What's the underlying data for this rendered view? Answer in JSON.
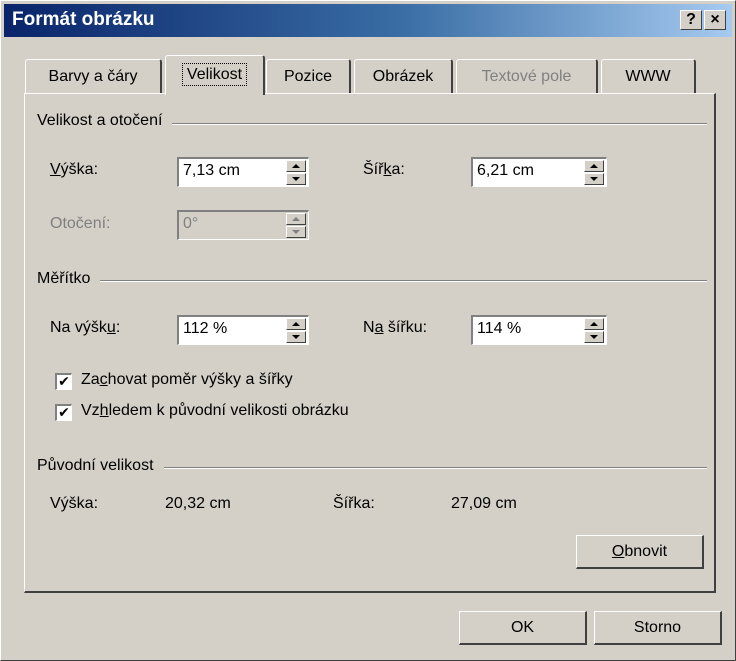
{
  "window": {
    "title": "Formát obrázku",
    "help_button": "?",
    "close_button": "×"
  },
  "tabs": [
    {
      "label": "Barvy a čáry",
      "active": false,
      "disabled": false
    },
    {
      "label": "Velikost",
      "active": true,
      "disabled": false
    },
    {
      "label": "Pozice",
      "active": false,
      "disabled": false
    },
    {
      "label": "Obrázek",
      "active": false,
      "disabled": false
    },
    {
      "label": "Textové pole",
      "active": false,
      "disabled": true
    },
    {
      "label": "WWW",
      "active": false,
      "disabled": false
    }
  ],
  "size_rotation": {
    "group_label": "Velikost a otočení",
    "height_label_accel": "V",
    "height_label_rest": "ýška:",
    "height_value": "7,13 cm",
    "width_label_pre": "Šíř",
    "width_label_accel": "k",
    "width_label_post": "a:",
    "width_value": "6,21 cm",
    "rotation_label": "Otočení:",
    "rotation_value": "0°"
  },
  "scale": {
    "group_label": "Měřítko",
    "height_label_pre": "Na výšk",
    "height_label_accel": "u",
    "height_label_post": ":",
    "height_value": "112 %",
    "width_label_pre": "N",
    "width_label_accel": "a",
    "width_label_post": " šířku:",
    "width_value": "114 %",
    "lock_ratio_pre": "Za",
    "lock_ratio_accel": "c",
    "lock_ratio_post": "hovat poměr výšky a šířky",
    "lock_ratio_checked": true,
    "relative_pre": "Vz",
    "relative_accel": "h",
    "relative_post": "ledem k původní velikosti obrázku",
    "relative_checked": true,
    "check_mark": "✔"
  },
  "original_size": {
    "group_label": "Původní velikost",
    "height_label": "Výška:",
    "height_value": "20,32 cm",
    "width_label": "Šířka:",
    "width_value": "27,09 cm",
    "reset_button_accel": "O",
    "reset_button_rest": "bnovit"
  },
  "footer": {
    "ok_label": "OK",
    "cancel_label": "Storno"
  }
}
